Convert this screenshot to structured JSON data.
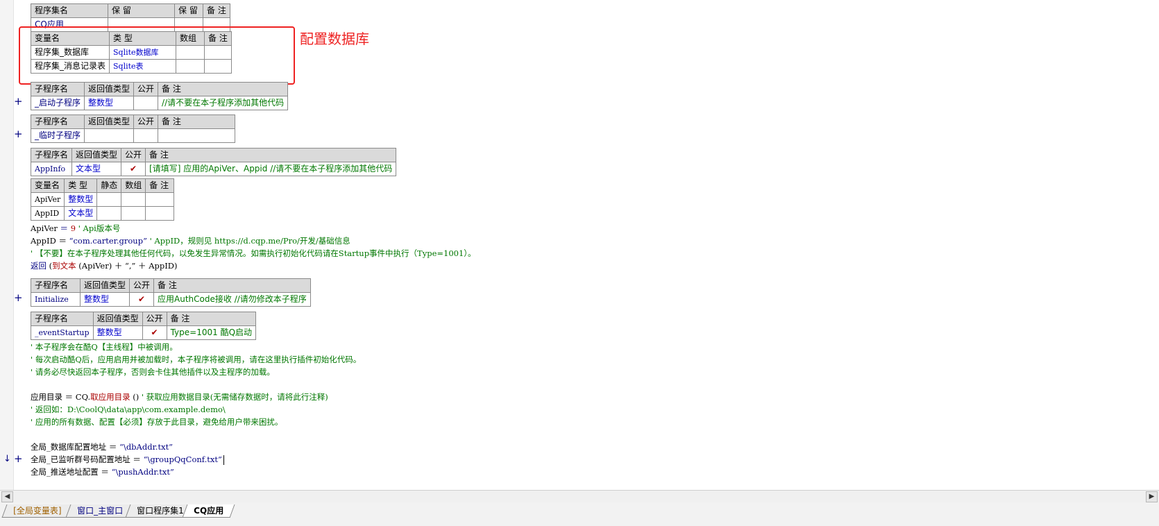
{
  "assembly_table": {
    "header": [
      "程序集名",
      "保 留",
      "保 留",
      "备 注"
    ],
    "row": [
      "CQ应用",
      "",
      "",
      ""
    ]
  },
  "assembly_vars": {
    "header": [
      "变量名",
      "类 型",
      "数组",
      "备 注"
    ],
    "rows": [
      [
        "程序集_数据库",
        "Sqlite数据库",
        "",
        ""
      ],
      [
        "程序集_消息记录表",
        "Sqlite表",
        "",
        ""
      ]
    ]
  },
  "annotation": {
    "label": "配置数据库",
    "color": "#ee2222"
  },
  "sub_header": [
    "子程序名",
    "返回值类型",
    "公开",
    "备 注"
  ],
  "subs": {
    "startup_sub": {
      "name": "_启动子程序",
      "type": "整数型",
      "public": "",
      "note": "//请不要在本子程序添加其他代码"
    },
    "temp_sub": {
      "name": "_临时子程序",
      "type": "",
      "public": "",
      "note": ""
    },
    "appinfo": {
      "name": "AppInfo",
      "type": "文本型",
      "public": "✔",
      "note": "[请填写] 应用的ApiVer、Appid //请不要在本子程序添加其他代码"
    },
    "initialize": {
      "name": "Initialize",
      "type": "整数型",
      "public": "✔",
      "note": "应用AuthCode接收 //请勿修改本子程序"
    },
    "event_startup": {
      "name": "_eventStartup",
      "type": "整数型",
      "public": "✔",
      "note": "Type=1001 酷Q启动"
    }
  },
  "appinfo_vars": {
    "header": [
      "变量名",
      "类 型",
      "静态",
      "数组",
      "备 注"
    ],
    "rows": [
      [
        "ApiVer",
        "整数型",
        "",
        "",
        ""
      ],
      [
        "AppID",
        "文本型",
        "",
        "",
        ""
      ]
    ]
  },
  "code_lines": {
    "l1": {
      "a": "ApiVer",
      "b": " ＝ ",
      "c": "9",
      "d": "  ' Api版本号"
    },
    "l2": {
      "a": "AppID ＝ ",
      "b": "“com.carter.group”",
      "c": "  ' AppID，规则见 https://d.cqp.me/Pro/开发/基础信息"
    },
    "l3": "' 【不要】在本子程序处理其他任何代码，以免发生异常情况。如需执行初始化代码请在Startup事件中执行（Type=1001）。",
    "l4": {
      "a": "返回",
      "b": " (",
      "c": "到文本",
      "d": " (ApiVer) ＋ “,” ＋ AppID)"
    },
    "c1": "' 本子程序会在酷Q【主线程】中被调用。",
    "c2": "' 每次启动酷Q后，应用启用并被加载时，本子程序将被调用，请在这里执行插件初始化代码。",
    "c3": "' 请务必尽快返回本子程序，否则会卡住其他插件以及主程序的加载。",
    "d1": {
      "a": "应用目录 ＝ CQ.",
      "b": "取应用目录",
      "c": " ()  ",
      "d": "' 获取应用数据目录(无需储存数据时，请将此行注释)"
    },
    "d2": "' 返回如：D:\\CoolQ\\data\\app\\com.example.demo\\",
    "d3": "' 应用的所有数据、配置【必须】存放于此目录，避免给用户带来困扰。",
    "g1": {
      "a": "全局_数据库配置地址 ＝ ",
      "b": "“\\dbAddr.txt”"
    },
    "g2": {
      "a": "全局_已监听群号码配置地址 ＝ ",
      "b": "“\\groupQqConf.txt”"
    },
    "g3": {
      "a": "全局_推送地址配置 ＝ ",
      "b": "“\\pushAddr.txt”"
    }
  },
  "gutter": {
    "plus": "+",
    "arrow": "↓"
  },
  "scroll": {
    "left": "◀",
    "right": "▶"
  },
  "tabs": [
    "[全局变量表]",
    "窗口_主窗口",
    "窗口程序集1",
    "CQ应用"
  ]
}
